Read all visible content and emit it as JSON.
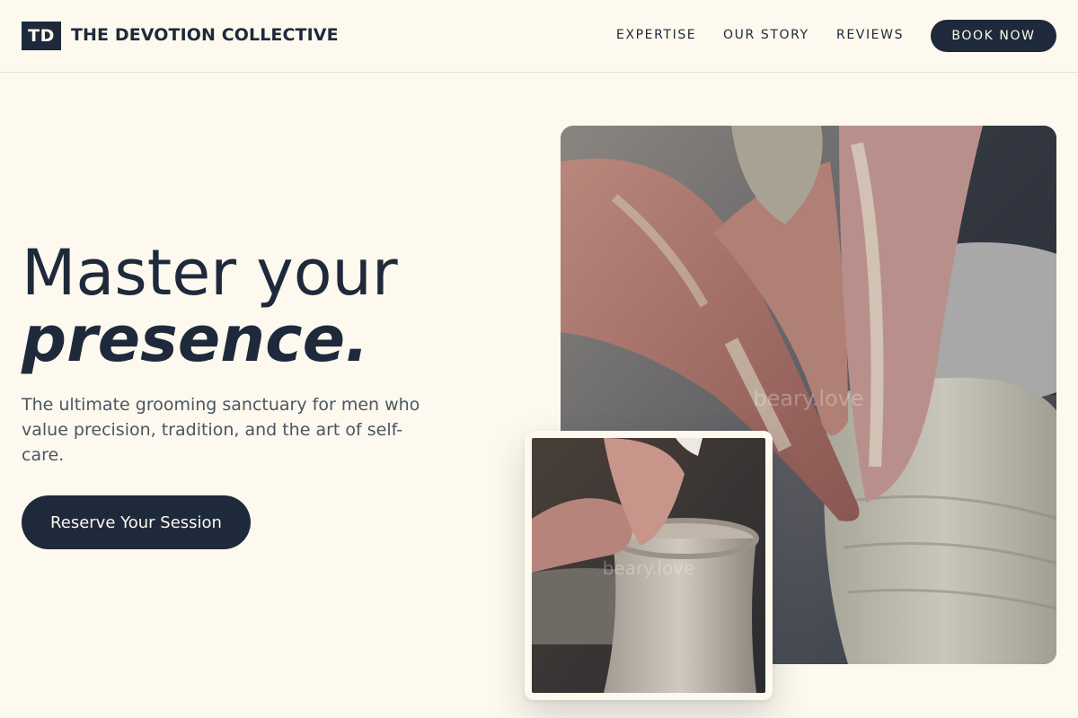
{
  "header": {
    "logo_initials": "TD",
    "brand_name": "THE DEVOTION COLLECTIVE",
    "nav": {
      "expertise": "EXPERTISE",
      "our_story": "OUR STORY",
      "reviews": "REVIEWS"
    },
    "book_now": "BOOK NOW"
  },
  "hero": {
    "headline_line1": "Master your",
    "headline_line2": "presence.",
    "subtitle": "The ultimate grooming sanctuary for men who value precision, tradition, and the art of self-care.",
    "cta_label": "Reserve Your Session"
  },
  "images": {
    "main_watermark": "beary.love",
    "inset_watermark": "beary.love"
  },
  "colors": {
    "background": "#fdf9ee",
    "primary_navy": "#1e293b",
    "body_text": "#4b5563"
  }
}
